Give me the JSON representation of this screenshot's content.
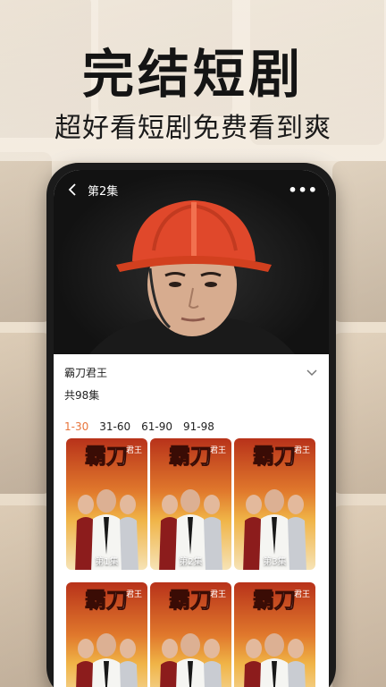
{
  "promo": {
    "title": "完结短剧",
    "subtitle": "超好看短剧免费看到爽"
  },
  "player": {
    "episode_label": "第2集"
  },
  "drama": {
    "title": "霸刀君王",
    "episode_count": "共98集"
  },
  "tabs": [
    {
      "label": "1-30",
      "active": true
    },
    {
      "label": "31-60",
      "active": false
    },
    {
      "label": "61-90",
      "active": false
    },
    {
      "label": "91-98",
      "active": false
    }
  ],
  "episodes": [
    {
      "label": "第1集"
    },
    {
      "label": "第2集"
    },
    {
      "label": "第3集"
    },
    {
      "label": ""
    },
    {
      "label": ""
    },
    {
      "label": ""
    }
  ],
  "poster": {
    "logo_text": "霸刀君王"
  },
  "colors": {
    "accent": "#e8743b",
    "helmet": "#e0482b"
  }
}
